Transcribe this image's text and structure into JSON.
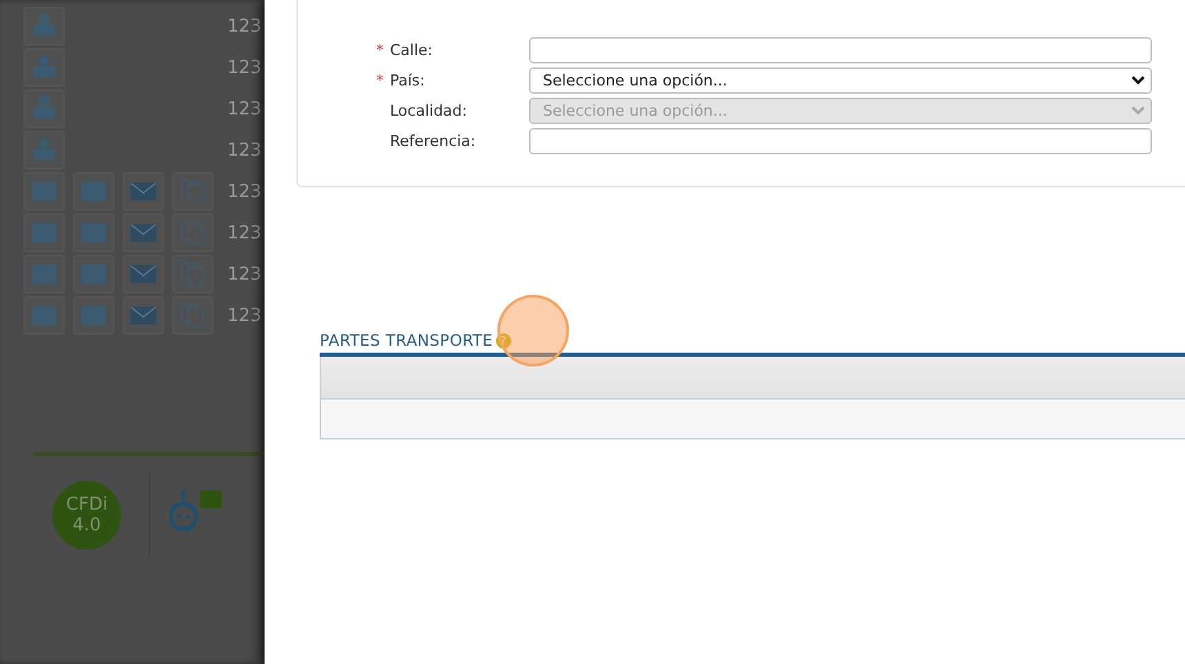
{
  "background_list": {
    "rows": [
      {
        "kind": "cfdi",
        "number": "123"
      },
      {
        "kind": "cfdi",
        "number": "123"
      },
      {
        "kind": "cfdi",
        "number": "123"
      },
      {
        "kind": "cfdi",
        "number": "123"
      },
      {
        "kind": "docs",
        "number": "123"
      },
      {
        "kind": "docs",
        "number": "123"
      },
      {
        "kind": "docs",
        "number": "123"
      },
      {
        "kind": "docs",
        "number": "123"
      }
    ]
  },
  "footer": {
    "badge_line_1": "CFDi",
    "badge_line_2": "4.0"
  },
  "form": {
    "fields": [
      {
        "label": "Calle:",
        "required_mark": "*",
        "kind": "text",
        "disabled": false
      },
      {
        "label": "País:",
        "required_mark": "*",
        "kind": "select",
        "value": "Seleccione una opción...",
        "disabled": false
      },
      {
        "label": "Localidad:",
        "kind": "select",
        "value": "Seleccione una opción...",
        "disabled": true
      },
      {
        "label": "Referencia:",
        "kind": "text",
        "disabled": false
      }
    ]
  },
  "section": {
    "title": "PARTES TRANSPORTE",
    "help": "?"
  }
}
